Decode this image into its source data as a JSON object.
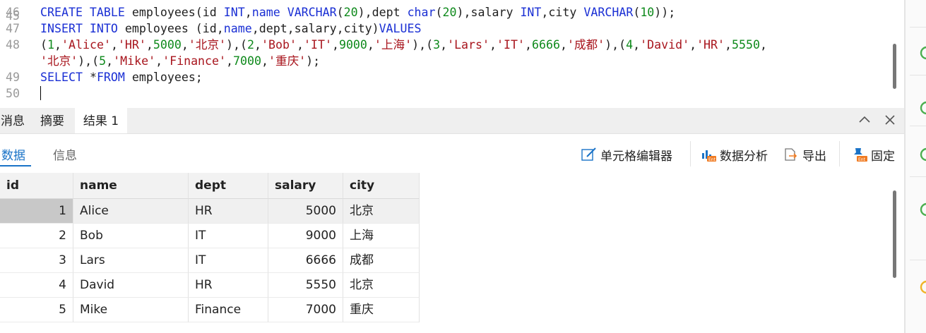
{
  "editor": {
    "lines": [
      {
        "num": "46",
        "tokens": [
          [
            "kw",
            "CREATE TABLE "
          ],
          [
            "pun",
            "employees(id "
          ],
          [
            "kw",
            "INT"
          ],
          [
            "pun",
            ","
          ],
          [
            "kw",
            "name"
          ],
          [
            "pun",
            " "
          ],
          [
            "kw",
            "VARCHAR"
          ],
          [
            "pun",
            "("
          ],
          [
            "num",
            "20"
          ],
          [
            "pun",
            "),dept "
          ],
          [
            "kw",
            "char"
          ],
          [
            "pun",
            "("
          ],
          [
            "num",
            "20"
          ],
          [
            "pun",
            "),salary "
          ],
          [
            "kw",
            "INT"
          ],
          [
            "pun",
            ",city "
          ],
          [
            "kw",
            "VARCHAR"
          ],
          [
            "pun",
            "("
          ],
          [
            "num",
            "10"
          ],
          [
            "pun",
            "));"
          ]
        ]
      },
      {
        "num": "47",
        "tokens": [
          [
            "kw",
            "INSERT INTO "
          ],
          [
            "pun",
            "employees (id,"
          ],
          [
            "kw",
            "name"
          ],
          [
            "pun",
            ",dept,salary,city)"
          ],
          [
            "kw",
            "VALUES"
          ]
        ]
      },
      {
        "num": "48",
        "tokens": [
          [
            "pun",
            "("
          ],
          [
            "num",
            "1"
          ],
          [
            "pun",
            ","
          ],
          [
            "str",
            "'Alice'"
          ],
          [
            "pun",
            ","
          ],
          [
            "str",
            "'HR'"
          ],
          [
            "pun",
            ","
          ],
          [
            "num",
            "5000"
          ],
          [
            "pun",
            ","
          ],
          [
            "str",
            "'北京'"
          ],
          [
            "pun",
            "),("
          ],
          [
            "num",
            "2"
          ],
          [
            "pun",
            ","
          ],
          [
            "str",
            "'Bob'"
          ],
          [
            "pun",
            ","
          ],
          [
            "str",
            "'IT'"
          ],
          [
            "pun",
            ","
          ],
          [
            "num",
            "9000"
          ],
          [
            "pun",
            ","
          ],
          [
            "str",
            "'上海'"
          ],
          [
            "pun",
            "),("
          ],
          [
            "num",
            "3"
          ],
          [
            "pun",
            ","
          ],
          [
            "str",
            "'Lars'"
          ],
          [
            "pun",
            ","
          ],
          [
            "str",
            "'IT'"
          ],
          [
            "pun",
            ","
          ],
          [
            "num",
            "6666"
          ],
          [
            "pun",
            ","
          ],
          [
            "str",
            "'成都'"
          ],
          [
            "pun",
            "),("
          ],
          [
            "num",
            "4"
          ],
          [
            "pun",
            ","
          ],
          [
            "str",
            "'David'"
          ],
          [
            "pun",
            ","
          ],
          [
            "str",
            "'HR'"
          ],
          [
            "pun",
            ","
          ],
          [
            "num",
            "5550"
          ],
          [
            "pun",
            ","
          ]
        ]
      },
      {
        "num": "",
        "tokens": [
          [
            "str",
            "'北京'"
          ],
          [
            "pun",
            "),("
          ],
          [
            "num",
            "5"
          ],
          [
            "pun",
            ","
          ],
          [
            "str",
            "'Mike'"
          ],
          [
            "pun",
            ","
          ],
          [
            "str",
            "'Finance'"
          ],
          [
            "pun",
            ","
          ],
          [
            "num",
            "7000"
          ],
          [
            "pun",
            ","
          ],
          [
            "str",
            "'重庆'"
          ],
          [
            "pun",
            ");"
          ]
        ]
      },
      {
        "num": "49",
        "tokens": [
          [
            "kw",
            "SELECT "
          ],
          [
            "pun",
            "*"
          ],
          [
            "kw",
            "FROM "
          ],
          [
            "pun",
            "employees;"
          ]
        ]
      },
      {
        "num": "50",
        "tokens": []
      }
    ]
  },
  "result_tabs": {
    "items": [
      "消息",
      "摘要",
      "结果 1"
    ],
    "active": "结果 1"
  },
  "sub_tabs": {
    "items": [
      "数据",
      "信息"
    ],
    "active": "数据"
  },
  "toolbar": {
    "cell_editor": "单元格编辑器",
    "data_analysis": "数据分析",
    "export": "导出",
    "pin": "固定"
  },
  "table": {
    "columns": [
      "id",
      "name",
      "dept",
      "salary",
      "city"
    ],
    "rows": [
      [
        "1",
        "Alice",
        "HR",
        "5000",
        "北京"
      ],
      [
        "2",
        "Bob",
        "IT",
        "9000",
        "上海"
      ],
      [
        "3",
        "Lars",
        "IT",
        "6666",
        "成都"
      ],
      [
        "4",
        "David",
        "HR",
        "5550",
        "北京"
      ],
      [
        "5",
        "Mike",
        "Finance",
        "7000",
        "重庆"
      ]
    ],
    "selected_row": 0
  },
  "colors": {
    "keyword": "#1a2fd4",
    "string": "#a8151d",
    "number": "#0f8a1c",
    "accent": "#1a73c7",
    "status_green": "#4caf50",
    "status_orange": "#f0b429"
  }
}
